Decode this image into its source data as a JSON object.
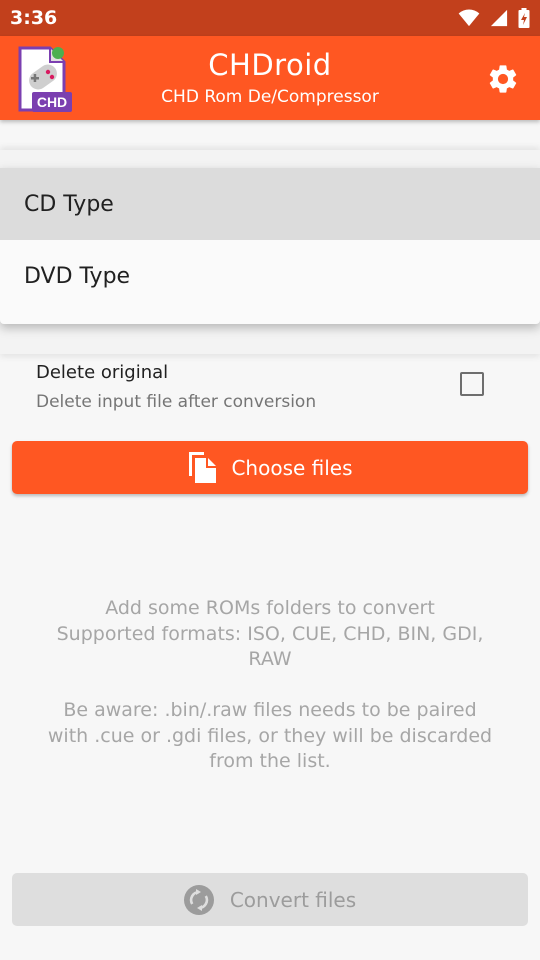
{
  "status_bar": {
    "time": "3:36",
    "icons": [
      "wifi-icon",
      "signal-icon",
      "battery-charging-icon"
    ]
  },
  "app_bar": {
    "title": "CHDroid",
    "subtitle": "CHD Rom De/Compressor",
    "logo_text": "CHD",
    "settings_icon": "gear-icon"
  },
  "colors": {
    "primary": "#ff5722",
    "primary_dark": "#c2401c",
    "disabled": "#dedede"
  },
  "dropdown": {
    "options": [
      {
        "label": "CD Type",
        "selected": true
      },
      {
        "label": "DVD Type",
        "selected": false
      }
    ]
  },
  "delete_option": {
    "title": "Delete original",
    "subtitle": "Delete input file after conversion",
    "checked": false
  },
  "choose_button": {
    "label": "Choose files",
    "icon": "copy-files-icon"
  },
  "info": {
    "line1": "Add some ROMs folders to convert",
    "line2": "Supported formats: ISO, CUE, CHD, BIN, GDI,",
    "line3": "RAW",
    "line4": "Be aware: .bin/.raw files needs to be paired",
    "line5": "with .cue or .gdi files, or they will be discarded",
    "line6": "from the list."
  },
  "convert_button": {
    "label": "Convert files",
    "icon": "sync-icon",
    "enabled": false
  }
}
